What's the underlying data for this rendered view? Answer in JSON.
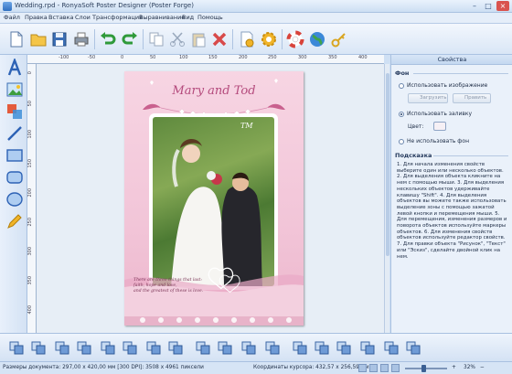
{
  "window": {
    "title": "Wedding.rpd - RonyaSoft Poster Designer (Poster Forge)",
    "controls": [
      "minimize-icon",
      "maximize-icon",
      "close-icon"
    ]
  },
  "menu": [
    "Файл",
    "Правка",
    "Вставка",
    "Слои",
    "Трансформация",
    "Выравнивание",
    "Вид",
    "Помощь"
  ],
  "toolbar": {
    "icons": [
      "new-document-icon",
      "open-folder-icon",
      "save-icon",
      "print-icon",
      "undo-icon",
      "redo-icon",
      "copy-icon",
      "cut-icon",
      "paste-icon",
      "delete-icon",
      "document-properties-icon",
      "settings-gear-icon",
      "help-lifebuoy-icon",
      "web-globe-icon",
      "key-icon"
    ]
  },
  "tools": [
    "text-tool-icon",
    "image-tool-icon",
    "shapes-tool-icon",
    "line-tool-icon",
    "rectangle-tool-icon",
    "rounded-rect-tool-icon",
    "ellipse-tool-icon",
    "pen-tool-icon"
  ],
  "ruler": {
    "top": [
      "-100",
      "-50",
      "0",
      "50",
      "100",
      "150",
      "200",
      "250",
      "300",
      "350",
      "400"
    ],
    "left": [
      "0",
      "50",
      "100",
      "150",
      "200",
      "250",
      "300",
      "350",
      "400"
    ]
  },
  "poster": {
    "title": "Mary and Tod",
    "monogram": "ТМ",
    "poem": [
      "There are three things that last:",
      "faith, hope and love,",
      "and the greatest of these is love."
    ]
  },
  "panel": {
    "header": "Свойства",
    "background_section": "Фон",
    "opt_image": "Использовать изображение",
    "btn_load": "Загрузить",
    "btn_edit": "Править",
    "opt_fill": "Использовать заливку",
    "color_label": "Цвет:",
    "opt_none": "Не использовать фон",
    "hint_section": "Подсказка",
    "hint_text": "1. Для начала изменения свойств выберите один или несколько объектов. 2. Для выделения объекта кликните на нем с помощью мыши. 3. Для выделения нескольких объектов удерживайте клавишу \"Shift\". 4. Для выделения объектов вы можете также использовать выделение зоны с помощью зажатой левой кнопки и перемещения мыши. 5. Для перемещения, изменения размеров и поворота объектов используйте маркеры объектов. 6. Для изменения свойств объектов используйте редактор свойств. 7. Для правки объекта \"Рисунок\", \"Текст\" или \"Эскиз\", сделайте двойной клик на нем."
  },
  "bottom_tools": [
    "group-icon",
    "ungroup-icon",
    "bring-front-icon",
    "send-back-icon",
    "bring-forward-icon",
    "send-backward-icon",
    "fit-width-icon",
    "fit-height-icon",
    "rotate-left-icon",
    "rotate-right-icon",
    "flip-horizontal-icon",
    "flip-vertical-icon",
    "align-left-icon",
    "align-center-icon",
    "align-right-icon",
    "align-top-icon",
    "align-middle-icon",
    "align-bottom-icon"
  ],
  "status": {
    "doc_size": "Размеры документа: 297,00 x 420,00 мм [300 DPI]: 3508 x 4961 пиксели",
    "cursor": "Координаты курсора: 432,57 x 256,59 мм",
    "zoom": "32%"
  }
}
